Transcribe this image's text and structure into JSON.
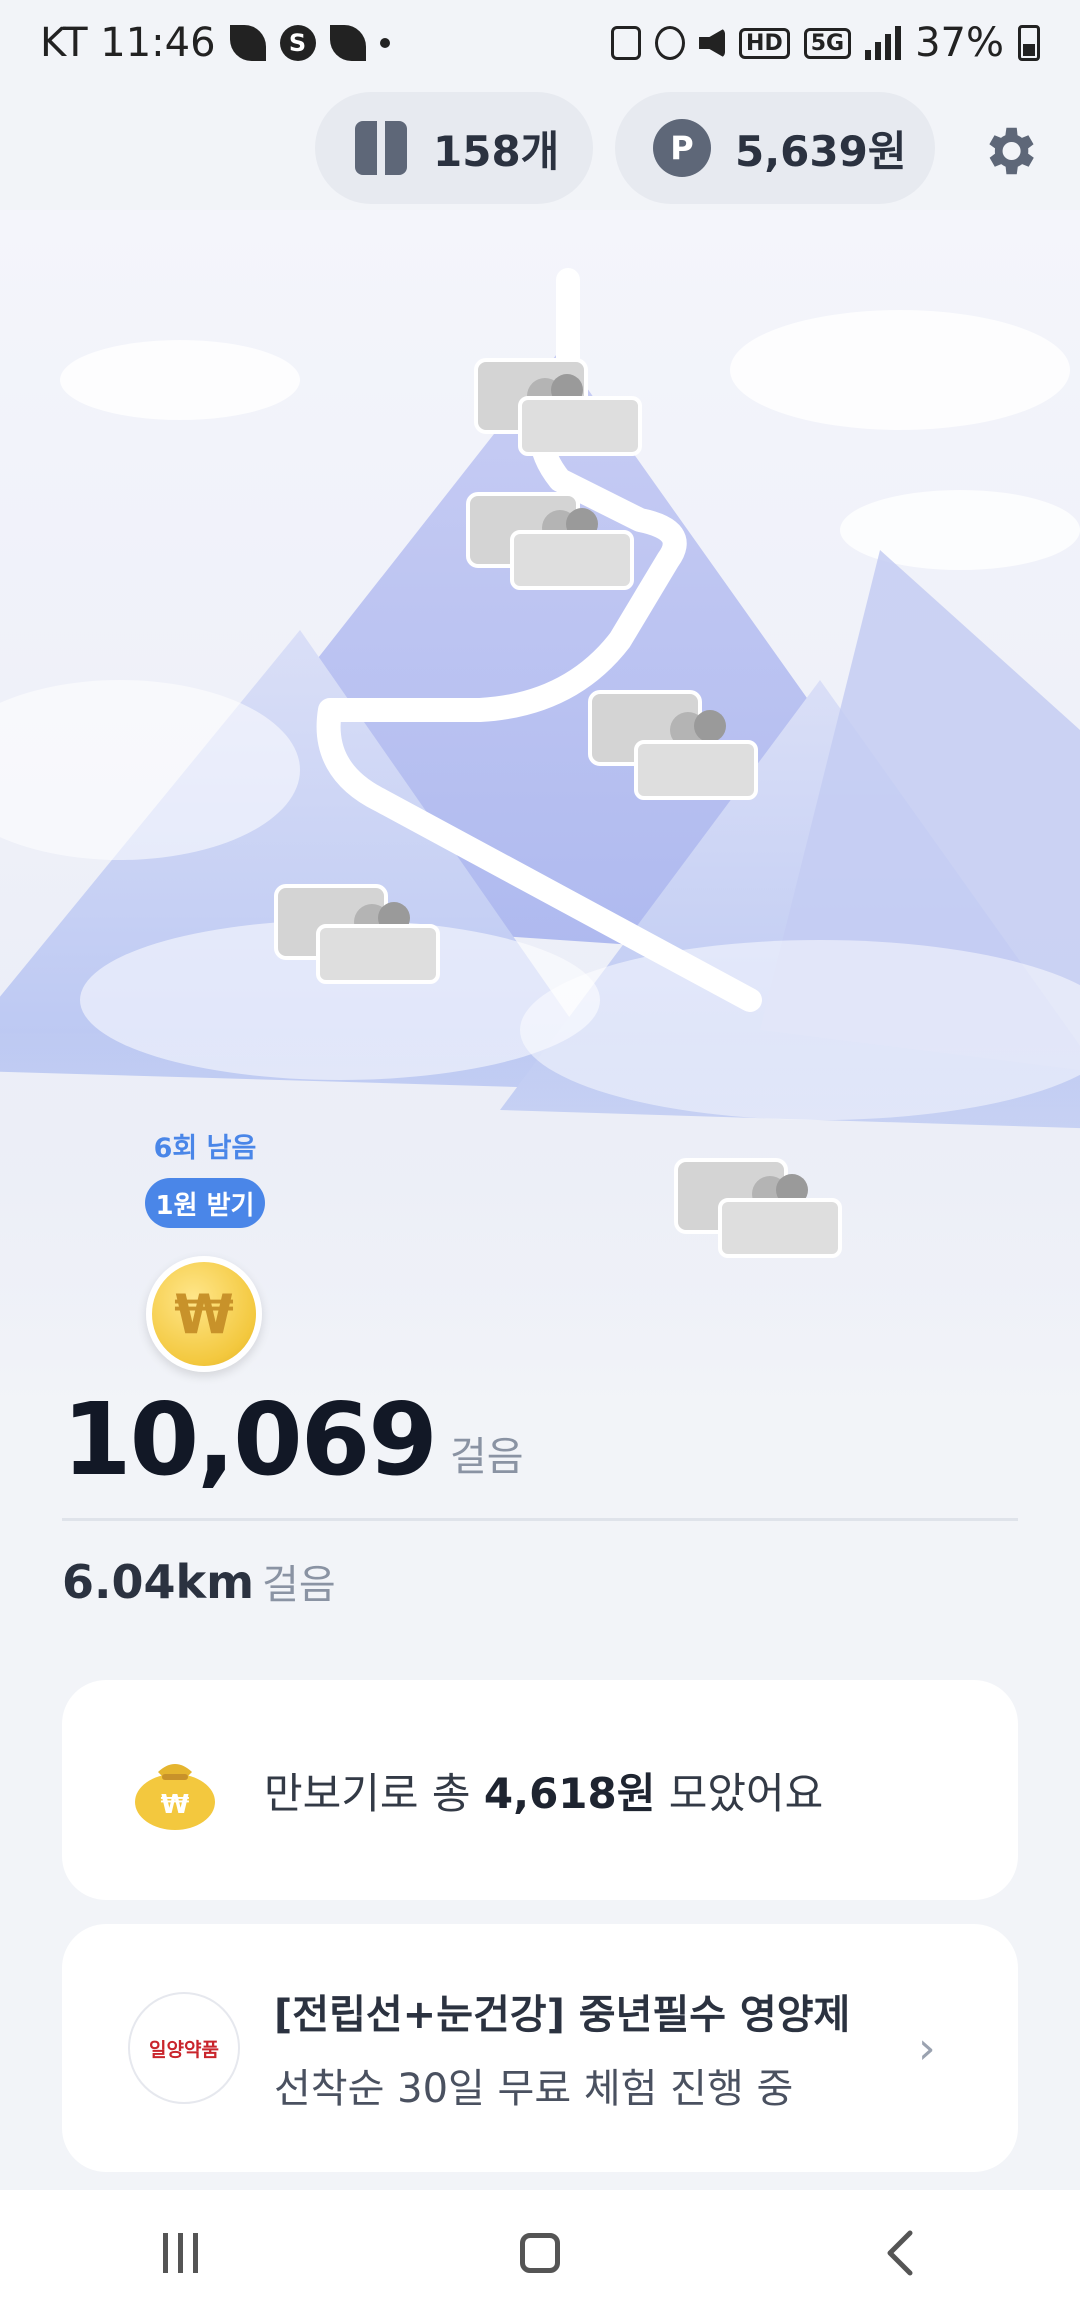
{
  "status_bar": {
    "carrier_time": "KT 11:46",
    "net_hd": "HD",
    "net_5g": "5G",
    "battery_percent": "37%"
  },
  "top": {
    "box_count": "158개",
    "points": "5,639원",
    "settings_icon": "gear-icon"
  },
  "reward": {
    "remaining": "6회 남음",
    "get_button": "1원 받기",
    "coin_symbol": "₩"
  },
  "stats": {
    "steps": "10,069",
    "steps_unit": "걸음",
    "distance": "6.04km",
    "distance_unit": "걸음"
  },
  "total_card": {
    "prefix": "만보기로 총 ",
    "amount": "4,618원",
    "suffix": " 모았어요"
  },
  "ad_card": {
    "logo_text": "일양약품",
    "title": "[전립선+눈건강] 중년필수 영양제",
    "subtitle": "선착순 30일 무료 체험 진행 중",
    "chevron": "›"
  },
  "colors": {
    "accent": "#4a86e8",
    "text_dark": "#121826",
    "coin": "#f3c83e"
  }
}
